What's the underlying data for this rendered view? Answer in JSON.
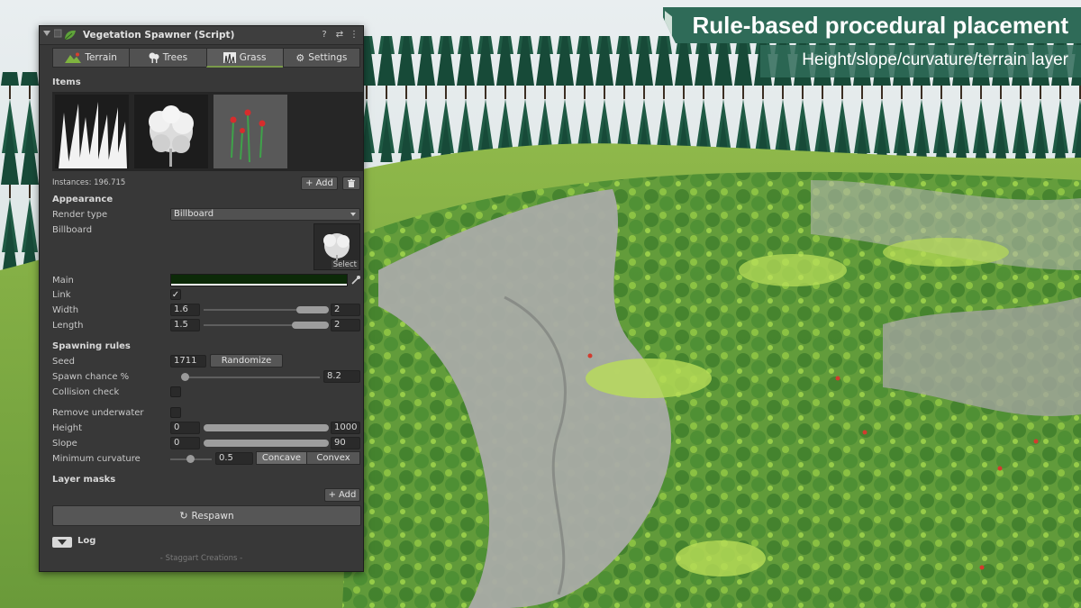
{
  "banner": {
    "title": "Rule-based procedural placement",
    "subtitle": "Height/slope/curvature/terrain layer"
  },
  "inspector": {
    "title": "Vegetation Spawner (Script)",
    "tabs": [
      {
        "label": "Terrain",
        "icon": "terrain-icon"
      },
      {
        "label": "Trees",
        "icon": "trees-icon"
      },
      {
        "label": "Grass",
        "icon": "grass-icon",
        "active": true
      },
      {
        "label": "Settings",
        "icon": "gear-icon"
      }
    ],
    "items_label": "Items",
    "instances_label": "Instances: 196.715",
    "add_label": "Add",
    "appearance": {
      "heading": "Appearance",
      "render_type_label": "Render type",
      "render_type_value": "Billboard",
      "billboard_label": "Billboard",
      "select_label": "Select",
      "main_label": "Main",
      "main_color": "#0c2a08",
      "link_label": "Link",
      "link_checked": "✓",
      "width_label": "Width",
      "width_min": "1.6",
      "width_max": "2",
      "length_label": "Length",
      "length_min": "1.5",
      "length_max": "2"
    },
    "spawning": {
      "heading": "Spawning rules",
      "seed_label": "Seed",
      "seed_value": "1711",
      "randomize_label": "Randomize",
      "spawn_chance_label": "Spawn chance %",
      "spawn_chance_value": "8.2",
      "collision_label": "Collision check",
      "underwater_label": "Remove underwater",
      "height_label": "Height",
      "height_min": "0",
      "height_max": "1000",
      "slope_label": "Slope",
      "slope_min": "0",
      "slope_max": "90",
      "curvature_label": "Minimum curvature",
      "curvature_value": "0.5",
      "concave_label": "Concave",
      "convex_label": "Convex"
    },
    "layer_masks": {
      "heading": "Layer masks",
      "add_label": "Add"
    },
    "respawn_label": "Respawn",
    "log_label": "Log",
    "footer": "- Staggart Creations -"
  }
}
